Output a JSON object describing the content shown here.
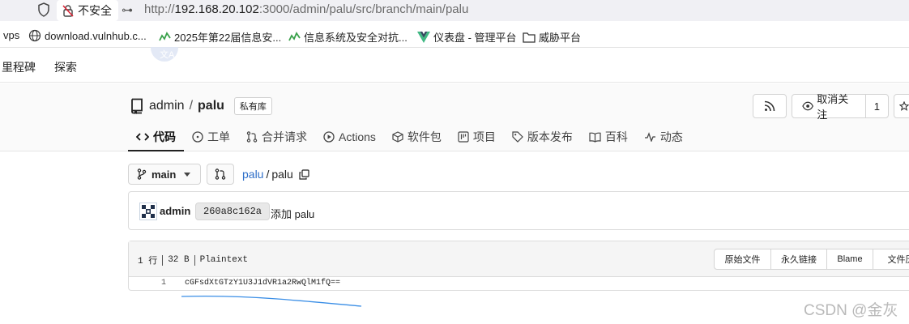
{
  "browser": {
    "security_label": "不安全",
    "url_prefix": "http://",
    "url_host": "192.168.20.102",
    "url_rest": ":3000/admin/palu/src/branch/main/palu"
  },
  "bookmarks": [
    {
      "label": "vps"
    },
    {
      "label": "download.vulnhub.c..."
    },
    {
      "label": "2025年第22届信息安..."
    },
    {
      "label": "信息系统及安全对抗..."
    },
    {
      "label": "仪表盘 - 管理平台"
    },
    {
      "label": "威胁平台"
    }
  ],
  "topnav": {
    "milestones": "里程碑",
    "explore": "探索"
  },
  "repo": {
    "owner": "admin",
    "separator": "/",
    "name": "palu",
    "private_badge": "私有库",
    "watch_label": "取消关注",
    "watch_count": "1"
  },
  "tabs": [
    {
      "label": "代码",
      "icon": "code-icon"
    },
    {
      "label": "工单",
      "icon": "issue-icon"
    },
    {
      "label": "合并请求",
      "icon": "pull-request-icon"
    },
    {
      "label": "Actions",
      "icon": "play-icon"
    },
    {
      "label": "软件包",
      "icon": "package-icon"
    },
    {
      "label": "项目",
      "icon": "project-icon"
    },
    {
      "label": "版本发布",
      "icon": "tag-icon"
    },
    {
      "label": "百科",
      "icon": "book-icon"
    },
    {
      "label": "动态",
      "icon": "pulse-icon"
    }
  ],
  "branch": {
    "name": "main"
  },
  "path": {
    "repo": "palu",
    "separator": "/",
    "file": "palu"
  },
  "commit": {
    "author": "admin",
    "sha": "260a8c162a",
    "message": "添加 palu"
  },
  "file": {
    "lines": "1 行",
    "size": "32 B",
    "type": "Plaintext",
    "raw_label": "原始文件",
    "permalink_label": "永久链接",
    "blame_label": "Blame",
    "history_label": "文件历",
    "line_number": "1",
    "content": "cGFsdXtGTzY1U3J1dVR1a2RwQlM1fQ=="
  },
  "watermark": "CSDN @金灰",
  "colors": {
    "link": "#2d6ec8",
    "underline": "#3a8ee6"
  }
}
